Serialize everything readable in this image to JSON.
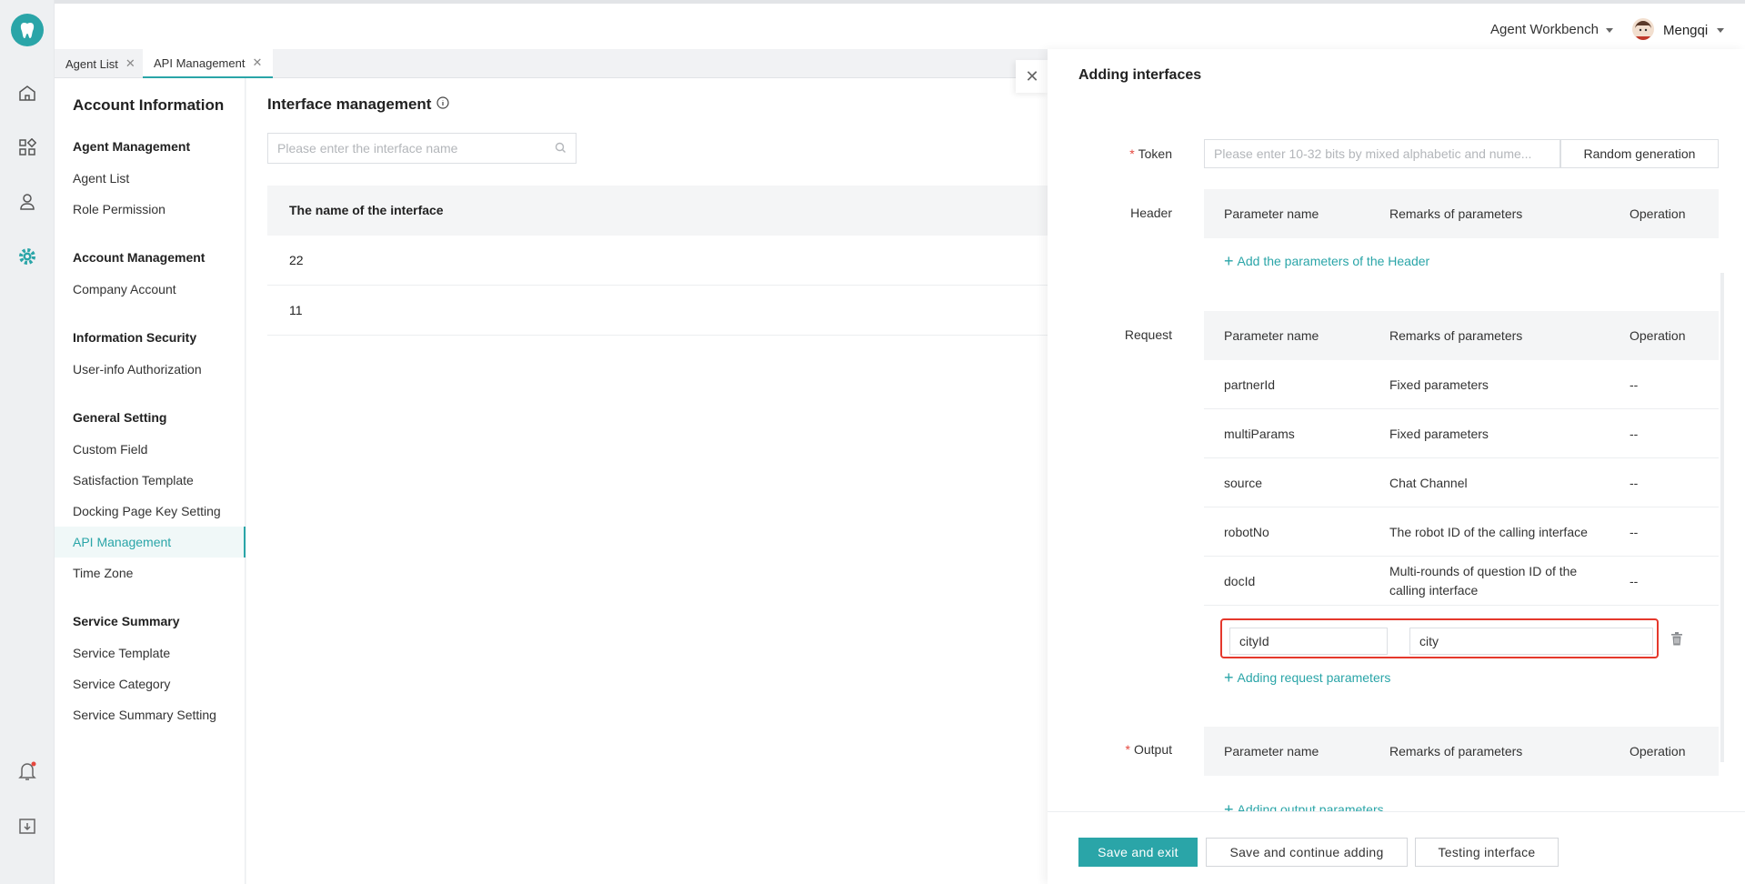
{
  "app": {
    "brand_color": "#2aa5a8",
    "required_color": "#e5483f",
    "highlight_color": "#e5382c"
  },
  "rail": {
    "icons": [
      "logo-tooth-icon",
      "home-icon",
      "apps-icon",
      "contacts-icon",
      "settings-icon",
      "bell-icon",
      "download-icon"
    ]
  },
  "topbar": {
    "workspace": "Agent Workbench",
    "user": "Mengqi"
  },
  "tabs": [
    {
      "label": "Agent List"
    },
    {
      "label": "API Management"
    }
  ],
  "sidemenu": {
    "title": "Account Information",
    "groups": [
      {
        "label": "Agent Management",
        "items": [
          "Agent List",
          "Role Permission"
        ]
      },
      {
        "label": "Account Management",
        "items": [
          "Company Account"
        ]
      },
      {
        "label": "Information Security",
        "items": [
          "User-info Authorization"
        ]
      },
      {
        "label": "General Setting",
        "items": [
          "Custom Field",
          "Satisfaction Template",
          "Docking Page Key Setting",
          "API Management",
          "Time Zone"
        ]
      },
      {
        "label": "Service Summary",
        "items": [
          "Service Template",
          "Service Category",
          "Service Summary Setting"
        ]
      }
    ]
  },
  "main": {
    "title": "Interface management",
    "search_placeholder": "Please enter the interface name",
    "table_header": "The name of the interface",
    "rows": [
      "22",
      "11"
    ]
  },
  "drawer": {
    "title": "Adding interfaces",
    "token_label": "Token",
    "token_placeholder": "Please enter 10-32 bits by mixed alphabetic and nume...",
    "random_btn": "Random generation",
    "header_label": "Header",
    "request_label": "Request",
    "output_label": "Output",
    "col_name": "Parameter name",
    "col_remarks": "Remarks of parameters",
    "col_operation": "Operation",
    "add_header": "Add the parameters of the Header",
    "add_request": "Adding request parameters",
    "add_output": "Adding output parameters",
    "request_rows": [
      {
        "name": "partnerId",
        "remark": "Fixed parameters",
        "op": "--"
      },
      {
        "name": "multiParams",
        "remark": "Fixed parameters",
        "op": "--"
      },
      {
        "name": "source",
        "remark": "Chat Channel",
        "op": "--"
      },
      {
        "name": "robotNo",
        "remark": "The robot ID of the calling interface",
        "op": "--"
      },
      {
        "name": "docId",
        "remark": "Multi-rounds of question ID of the calling interface",
        "op": "--"
      }
    ],
    "edit_row": {
      "name": "cityId",
      "remark": "city"
    },
    "buttons": {
      "save_exit": "Save and exit",
      "save_continue": "Save and continue adding",
      "test": "Testing interface"
    }
  }
}
